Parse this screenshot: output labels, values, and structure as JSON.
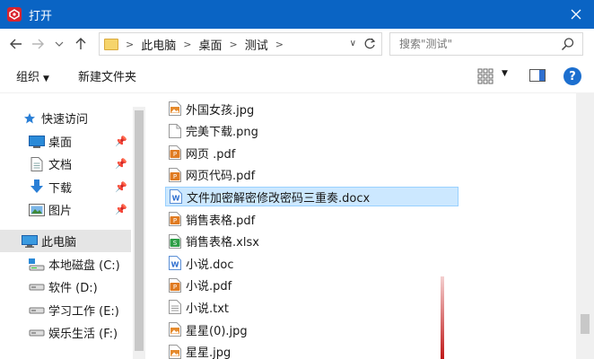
{
  "window": {
    "title": "打开"
  },
  "address": {
    "crumbs": [
      "此电脑",
      "桌面",
      "测试"
    ],
    "search_placeholder": "搜索\"测试\""
  },
  "toolbar": {
    "organize": "组织",
    "new_folder": "新建文件夹",
    "help": "?"
  },
  "nav": {
    "quick_access": "快速访问",
    "quick_items": [
      {
        "label": "桌面",
        "icon": "desktop-icon"
      },
      {
        "label": "文档",
        "icon": "document-icon"
      },
      {
        "label": "下载",
        "icon": "download-icon"
      },
      {
        "label": "图片",
        "icon": "picture-icon"
      }
    ],
    "this_pc": "此电脑",
    "drives": [
      {
        "label": "本地磁盘 (C:)"
      },
      {
        "label": "软件 (D:)"
      },
      {
        "label": "学习工作 (E:)"
      },
      {
        "label": "娱乐生活 (F:)"
      }
    ]
  },
  "files": [
    {
      "name": "外国女孩.jpg",
      "type": "jpg"
    },
    {
      "name": "完美下载.png",
      "type": "png"
    },
    {
      "name": "网页 .pdf",
      "type": "pdf"
    },
    {
      "name": "网页代码.pdf",
      "type": "pdf"
    },
    {
      "name": "文件加密解密修改密码三重奏.docx",
      "type": "docx",
      "selected": true
    },
    {
      "name": "销售表格.pdf",
      "type": "pdf"
    },
    {
      "name": "销售表格.xlsx",
      "type": "xlsx"
    },
    {
      "name": "小说.doc",
      "type": "doc"
    },
    {
      "name": "小说.pdf",
      "type": "pdf"
    },
    {
      "name": "小说.txt",
      "type": "txt"
    },
    {
      "name": "星星(0).jpg",
      "type": "jpg"
    },
    {
      "name": "星星.jpg",
      "type": "jpg"
    }
  ],
  "colors": {
    "titlebar": "#0a64c4",
    "selection": "#cce8ff",
    "pdf": "#e07b22",
    "xlsx": "#2e9e47",
    "doc": "#2f6fcf"
  }
}
